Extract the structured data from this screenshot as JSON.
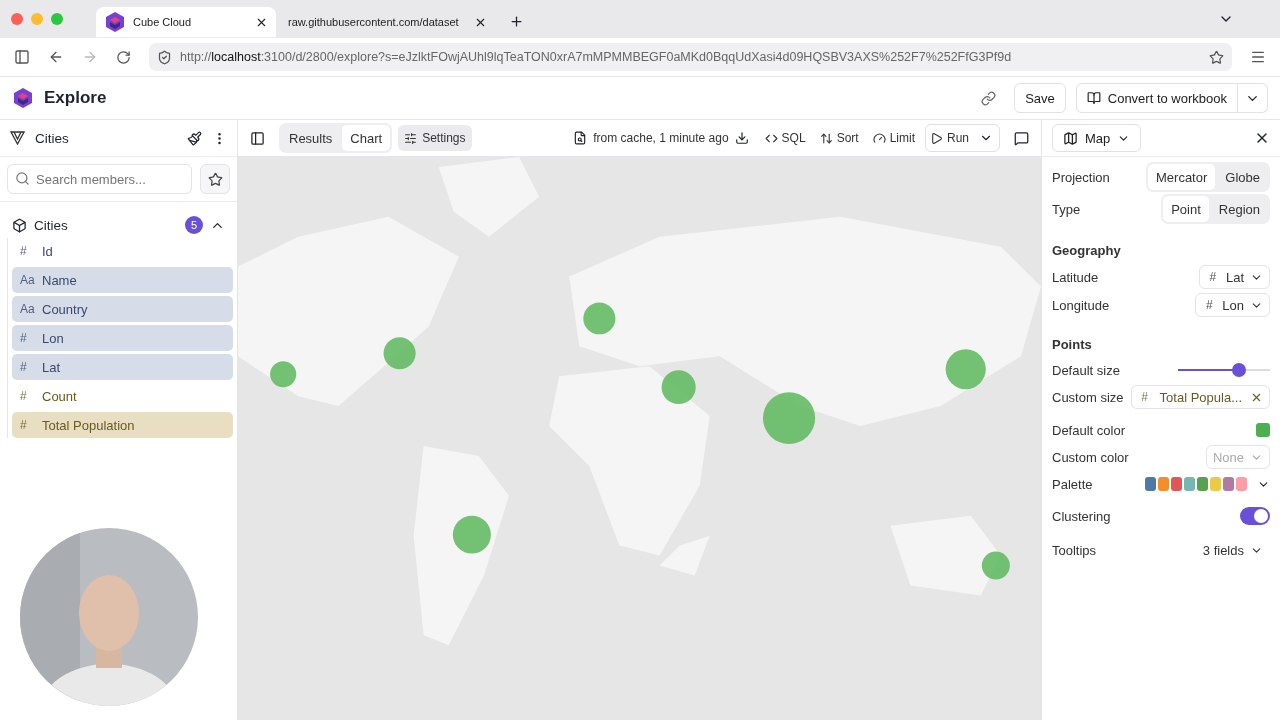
{
  "browser": {
    "tabs": [
      {
        "title": "Cube Cloud",
        "selected": true
      },
      {
        "title": "raw.githubusercontent.com/dataset",
        "selected": false
      }
    ],
    "url": {
      "scheme": "http://",
      "host": "localhost",
      "rest": ":3100/d/2800/explore?s=eJzlktFOwjAUhl9lqTeaTON0xrA7mMPMMBEGF0aMKd0BqqUdXasi4d09HQSBV3AXS%252F7%252FfG3Pf9d"
    }
  },
  "header": {
    "title": "Explore",
    "buttons": [
      "Save",
      "Convert to workbook"
    ]
  },
  "sidebar": {
    "cube": "Cities",
    "search": {
      "placeholder": "Search members..."
    },
    "group": {
      "name": "Cities",
      "count": "5",
      "expanded": true,
      "members": [
        {
          "type_icon": "#",
          "label": "Id",
          "kind": "dimension",
          "selected": false
        },
        {
          "type_icon": "Aa",
          "label": "Name",
          "kind": "dimension",
          "selected": true
        },
        {
          "type_icon": "Aa",
          "label": "Country",
          "kind": "dimension",
          "selected": true
        },
        {
          "type_icon": "#",
          "label": "Lon",
          "kind": "dimension",
          "selected": true
        },
        {
          "type_icon": "#",
          "label": "Lat",
          "kind": "dimension",
          "selected": true
        },
        {
          "type_icon": "#",
          "label": "Count",
          "kind": "measure",
          "selected": false
        },
        {
          "type_icon": "#",
          "label": "Total Population",
          "kind": "measure",
          "selected": true
        }
      ]
    }
  },
  "toolbar": {
    "tabs": [
      {
        "label": "Results",
        "selected": false
      },
      {
        "label": "Chart",
        "selected": true
      }
    ],
    "settings": {
      "label": "Settings",
      "active": true
    },
    "status": "from cache, 1 minute ago",
    "actions": [
      {
        "kind": "sql",
        "label": "SQL"
      },
      {
        "kind": "sort",
        "label": "Sort"
      },
      {
        "kind": "limit",
        "label": "Limit"
      }
    ],
    "run": "Run"
  },
  "panel": {
    "chart_type": "Map",
    "rows": [
      {
        "kind": "segmented",
        "label": "Projection",
        "options": [
          {
            "label": "Mercator",
            "selected": true
          },
          {
            "label": "Globe",
            "selected": false
          }
        ]
      },
      {
        "kind": "segmented",
        "label": "Type",
        "options": [
          {
            "label": "Point",
            "selected": true
          },
          {
            "label": "Region",
            "selected": false
          }
        ]
      },
      {
        "kind": "heading",
        "label": "Geography"
      },
      {
        "kind": "select",
        "label": "Latitude",
        "type_icon": "#",
        "value": "Lat"
      },
      {
        "kind": "select",
        "label": "Longitude",
        "type_icon": "#",
        "value": "Lon"
      },
      {
        "kind": "heading",
        "label": "Points"
      },
      {
        "kind": "slider",
        "label": "Default size",
        "level": 0.66
      },
      {
        "kind": "chip",
        "label": "Custom size",
        "type_icon": "#",
        "value": "Total Popula..."
      },
      {
        "kind": "color",
        "label": "Default color",
        "color": "#4caf50"
      },
      {
        "kind": "select",
        "label": "Custom color",
        "placeholder": "None"
      },
      {
        "kind": "palette",
        "label": "Palette",
        "colors": [
          {
            "color": "#4e79a7"
          },
          {
            "color": "#f28e2b"
          },
          {
            "color": "#e15759"
          },
          {
            "color": "#76b7b2"
          },
          {
            "color": "#59a14f"
          },
          {
            "color": "#edc948"
          },
          {
            "color": "#b07aa1"
          },
          {
            "color": "#ff9da7"
          }
        ]
      },
      {
        "kind": "toggle",
        "label": "Clustering",
        "on": true
      },
      {
        "kind": "menu",
        "label": "Tooltips",
        "value": "3 fields"
      }
    ]
  }
}
